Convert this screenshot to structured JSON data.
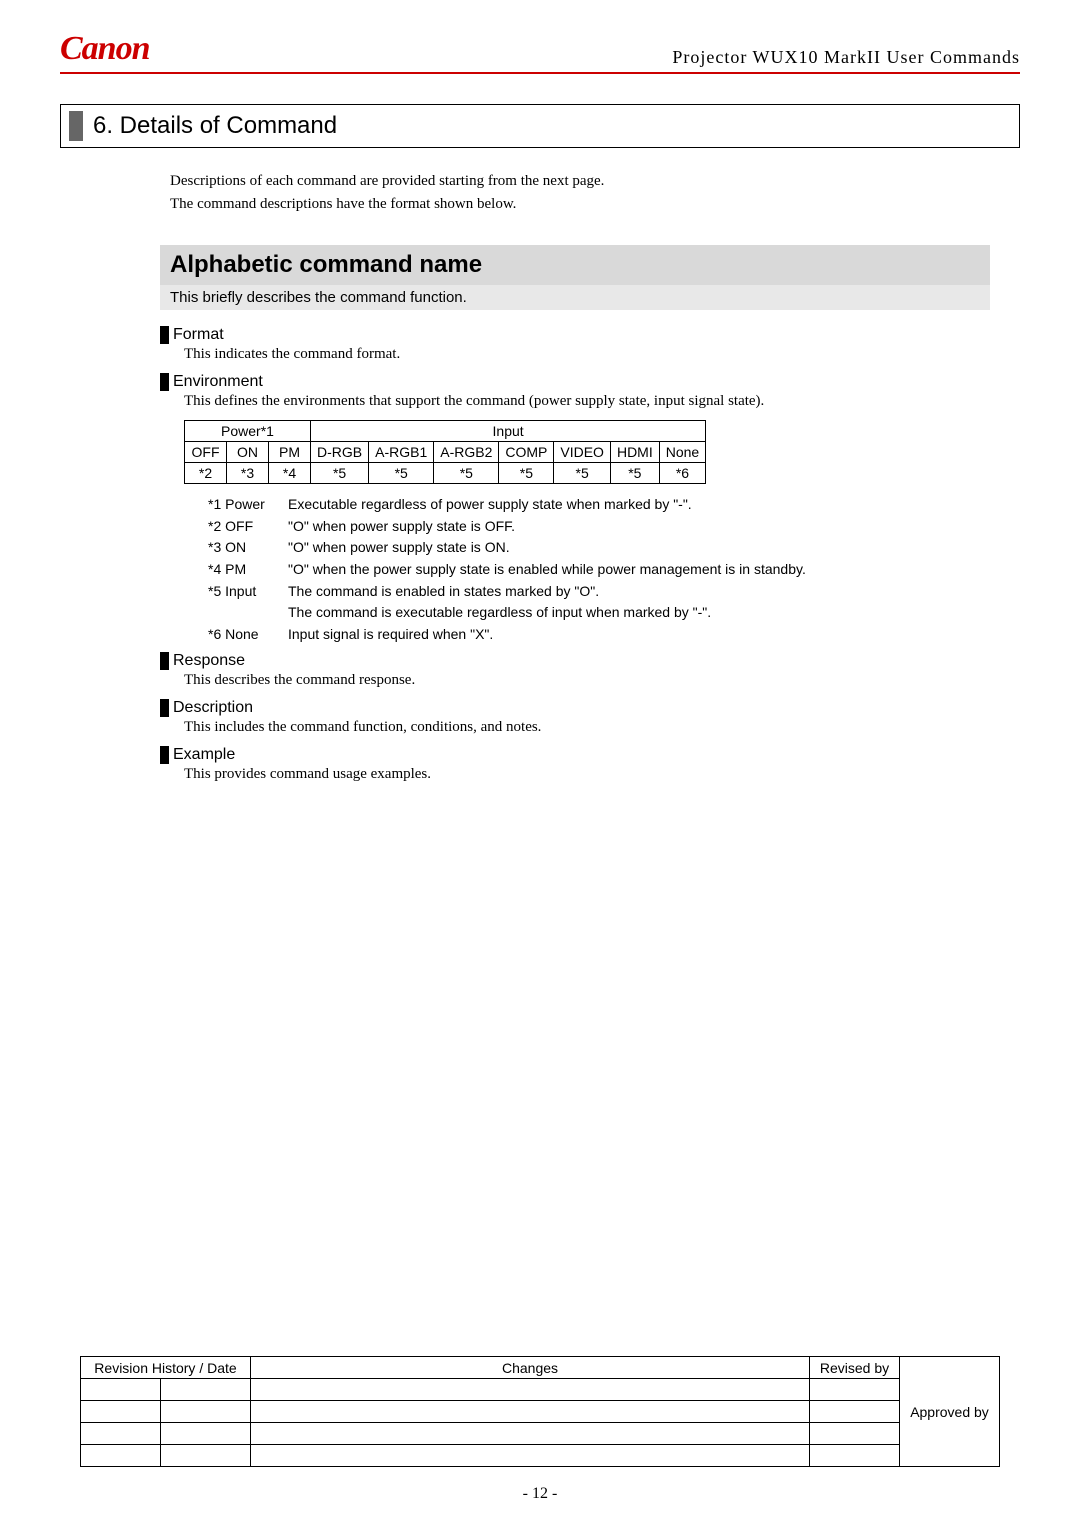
{
  "header": {
    "logo": "Canon",
    "doc_title": "Projector WUX10 MarkII User Commands"
  },
  "section": {
    "number_title": "6. Details of Command"
  },
  "intro": {
    "line1": "Descriptions of each command are provided starting from the next page.",
    "line2": "The command descriptions have the format shown below."
  },
  "cmd": {
    "title": "Alphabetic command name",
    "subtitle": "This briefly describes the command function."
  },
  "format": {
    "label": "Format",
    "desc": "This indicates the command format."
  },
  "environment": {
    "label": "Environment",
    "desc": "This defines the environments that support the command (power supply state, input signal state).",
    "table": {
      "group_headers": [
        "Power*1",
        "Input"
      ],
      "cols": [
        "OFF",
        "ON",
        "PM",
        "D-RGB",
        "A-RGB1",
        "A-RGB2",
        "COMP",
        "VIDEO",
        "HDMI",
        "None"
      ],
      "vals": [
        "*2",
        "*3",
        "*4",
        "*5",
        "*5",
        "*5",
        "*5",
        "*5",
        "*5",
        "*6"
      ]
    },
    "notes": [
      {
        "key": "*1 Power",
        "val": "Executable regardless of power supply state when marked by \"-\"."
      },
      {
        "key": "*2 OFF",
        "val": "\"O\" when power supply state is OFF."
      },
      {
        "key": "*3 ON",
        "val": "\"O\" when power supply state is ON."
      },
      {
        "key": "*4 PM",
        "val": "\"O\" when the power supply state is enabled while power management is in standby."
      },
      {
        "key": "*5 Input",
        "val": "The command is enabled in states marked by \"O\"."
      },
      {
        "key": "",
        "val": "The command is executable regardless of input when marked by \"-\"."
      },
      {
        "key": "*6 None",
        "val": "Input signal is required when \"X\"."
      }
    ]
  },
  "response": {
    "label": "Response",
    "desc": "This describes the command response."
  },
  "description": {
    "label": "Description",
    "desc": "This includes the command function, conditions, and notes."
  },
  "example": {
    "label": "Example",
    "desc": "This provides command usage examples."
  },
  "revision": {
    "headers": [
      "Revision History / Date",
      "Changes",
      "Revised by",
      "Approved by"
    ]
  },
  "page_number": "- 12 -"
}
